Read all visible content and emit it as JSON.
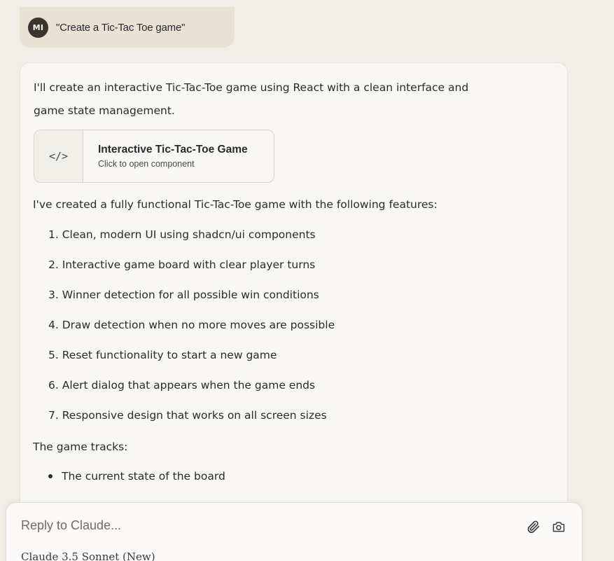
{
  "user_message": {
    "avatar_initials": "MI",
    "text": "\"Create a Tic-Tac Toe game\""
  },
  "assistant": {
    "intro_line1": "I'll create an interactive Tic-Tac-Toe game using React with a clean interface and",
    "intro_line2": "game state management.",
    "artifact": {
      "icon": "code-icon",
      "icon_glyph": "</>",
      "title": "Interactive Tic-Tac-Toe Game",
      "subtitle": "Click to open component"
    },
    "features_intro": "I've created a fully functional Tic-Tac-Toe game with the following features:",
    "features": [
      "1. Clean, modern UI using shadcn/ui components",
      "2. Interactive game board with clear player turns",
      "3. Winner detection for all possible win conditions",
      "4. Draw detection when no more moves are possible",
      "5. Reset functionality to start a new game",
      "6. Alert dialog that appears when the game ends",
      "7. Responsive design that works on all screen sizes"
    ],
    "tracks_label": "The game tracks:",
    "tracks": [
      "The current state of the board"
    ]
  },
  "reply": {
    "placeholder": "Reply to Claude...",
    "attach_icon": "paperclip-icon",
    "camera_icon": "camera-icon",
    "model_name": "Claude 3.5 Sonnet (New)"
  },
  "colors": {
    "background": "#f0eee6",
    "user_bubble": "#e7e2d3",
    "avatar": "#3a342c",
    "card": "#f8f7f4"
  }
}
